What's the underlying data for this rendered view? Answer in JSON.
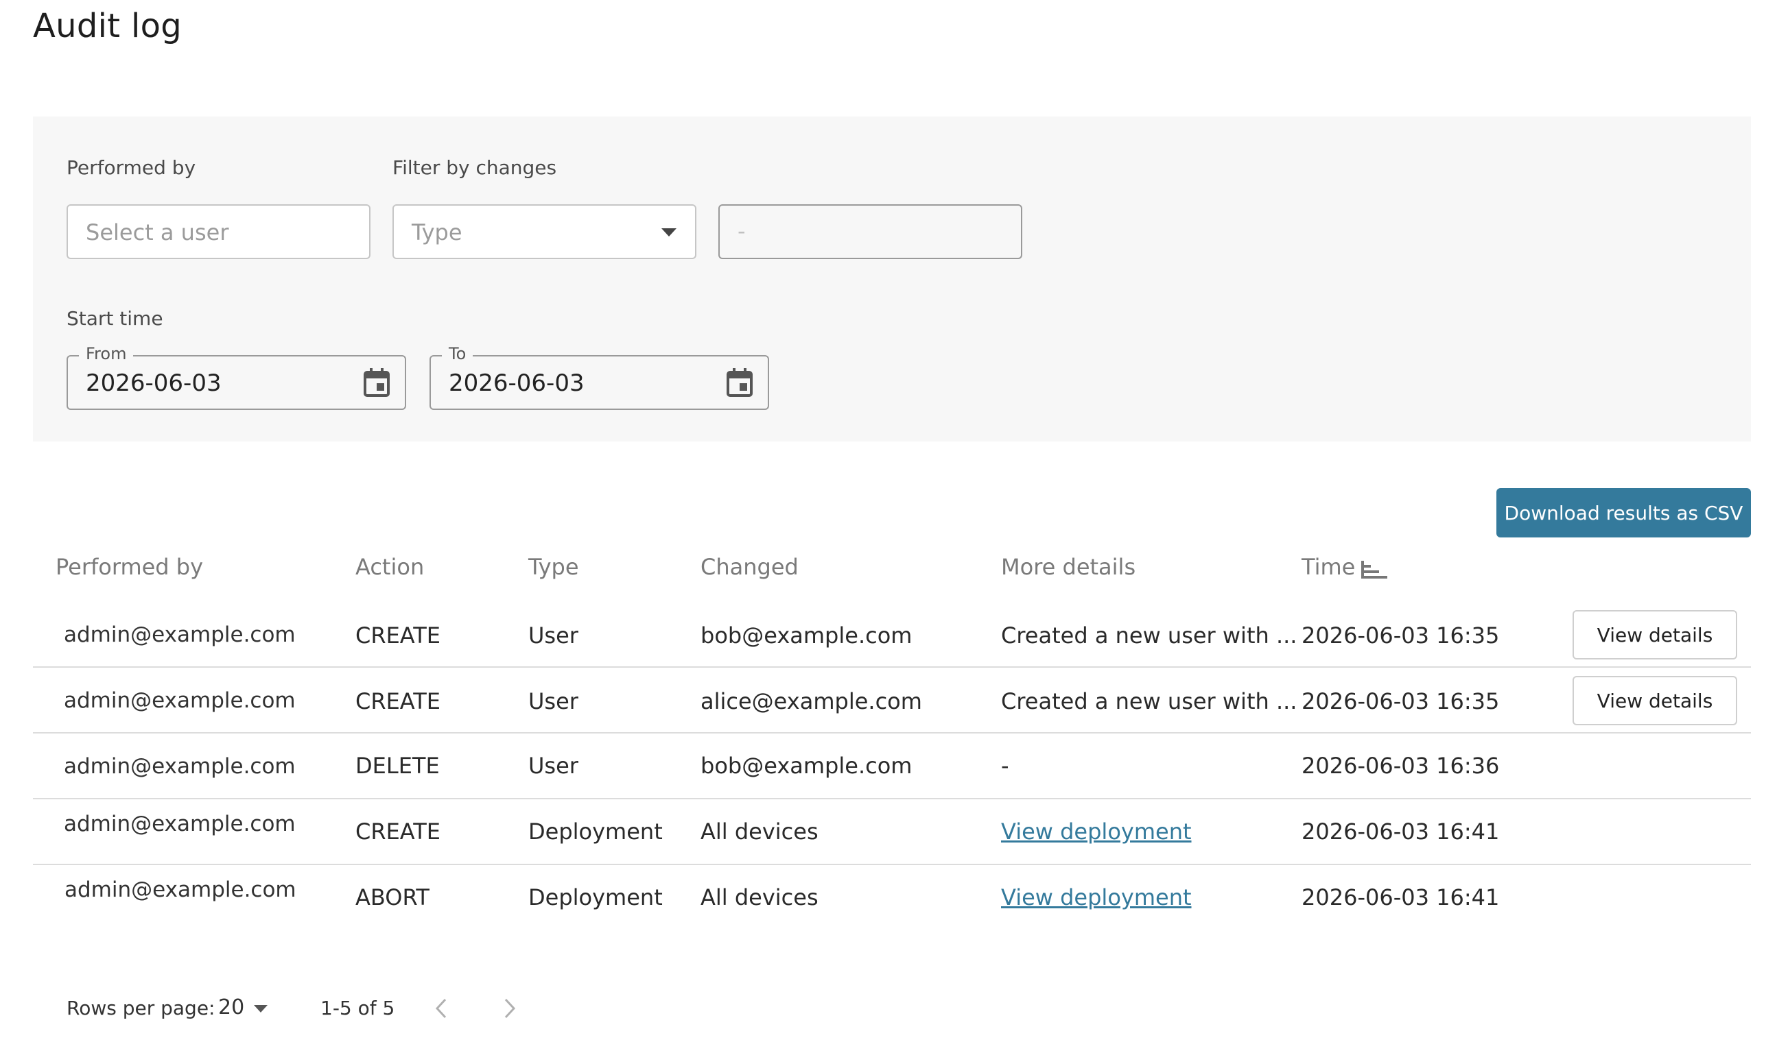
{
  "page": {
    "title": "Audit log"
  },
  "filters": {
    "performed_by_label": "Performed by",
    "performed_by_placeholder": "Select a user",
    "filter_by_changes_label": "Filter by changes",
    "type_placeholder": "Type",
    "detail_placeholder": "-",
    "start_time_label": "Start time",
    "from_label": "From",
    "from_value": "2026-06-03",
    "to_label": "To",
    "to_value": "2026-06-03"
  },
  "actions": {
    "download_csv_label": "Download results as CSV"
  },
  "table": {
    "columns": [
      "Performed by",
      "Action",
      "Type",
      "Changed",
      "More details",
      "Time"
    ],
    "rows": [
      {
        "performed_by": "admin@example.com",
        "action": "CREATE",
        "type": "User",
        "changed": "bob@example.com",
        "more_details": "Created a new user with ...",
        "time": "2026-06-03 16:35",
        "button": "View details"
      },
      {
        "performed_by": "admin@example.com",
        "action": "CREATE",
        "type": "User",
        "changed": "alice@example.com",
        "more_details": "Created a new user with ...",
        "time": "2026-06-03 16:35",
        "button": "View details"
      },
      {
        "performed_by": "admin@example.com",
        "action": "DELETE",
        "type": "User",
        "changed": "bob@example.com",
        "more_details": "-",
        "time": "2026-06-03 16:36"
      },
      {
        "performed_by": "admin@example.com",
        "action": "CREATE",
        "type": "Deployment",
        "changed": "All devices",
        "more_details_link": "View deployment",
        "time": "2026-06-03 16:41"
      },
      {
        "performed_by": "admin@example.com",
        "action": "ABORT",
        "type": "Deployment",
        "changed": "All devices",
        "more_details_link": "View deployment",
        "time": "2026-06-03 16:41"
      }
    ]
  },
  "pagination": {
    "rows_per_page_label": "Rows per page:",
    "rows_per_page_value": "20",
    "range_text": "1-5 of 5"
  },
  "icons": {
    "calendar": "calendar-icon",
    "dropdown": "caret-down-icon",
    "sort": "sort-icon",
    "prev": "chevron-left-icon",
    "next": "chevron-right-icon"
  },
  "colors": {
    "accent": "#347a9c",
    "panel_bg": "#f7f7f7"
  }
}
